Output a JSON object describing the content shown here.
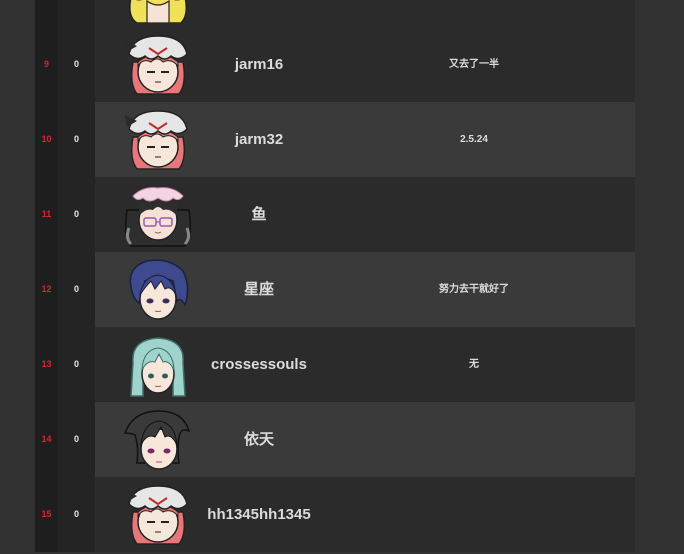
{
  "leaderboard": {
    "rows": [
      {
        "rank": "",
        "score": "",
        "name": "",
        "status": "",
        "avatar": "yellow-hair-avatar",
        "partial": true
      },
      {
        "rank": "9",
        "score": "0",
        "name": "jarm16",
        "status": "又去了一半",
        "avatar": "remilia-avatar"
      },
      {
        "rank": "10",
        "score": "0",
        "name": "jarm32",
        "status": "2.5.24",
        "avatar": "remilia-avatar"
      },
      {
        "rank": "11",
        "score": "0",
        "name": "鱼",
        "status": "",
        "avatar": "glasses-maid-avatar"
      },
      {
        "rank": "12",
        "score": "0",
        "name": "星座",
        "status": "努力去干就好了",
        "avatar": "blue-hair-avatar"
      },
      {
        "rank": "13",
        "score": "0",
        "name": "crossessouls",
        "status": "无",
        "avatar": "teal-hair-avatar"
      },
      {
        "rank": "14",
        "score": "0",
        "name": "依天",
        "status": "",
        "avatar": "black-hair-avatar"
      },
      {
        "rank": "15",
        "score": "0",
        "name": "hh1345hh1345",
        "status": "",
        "avatar": "remilia-avatar"
      }
    ]
  },
  "colors": {
    "rank": "#d8262a",
    "text": "#dcdcdc",
    "row_dark": "#2b2b2b",
    "row_light": "#3a3a3a"
  }
}
